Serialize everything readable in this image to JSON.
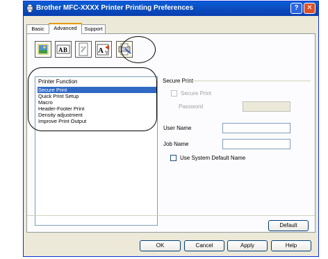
{
  "window": {
    "title": "Brother MFC-XXXX Printer Printing Preferences",
    "help": "?",
    "close": "✕"
  },
  "tabs": [
    "Basic",
    "Advanced",
    "Support"
  ],
  "toolbar": {
    "buttons": [
      {
        "name": "color-icon"
      },
      {
        "name": "scaling-icon"
      },
      {
        "name": "watermark-icon"
      },
      {
        "name": "print-setting-icon"
      },
      {
        "name": "device-options-icon"
      }
    ]
  },
  "printer_function": {
    "title": "Printer Function",
    "items": [
      "Secure Print",
      "Quick Print Setup",
      "Macro",
      "Header-Footer Print",
      "Density adjustment",
      "Improve Print Output"
    ],
    "selected_index": 0
  },
  "secure_print": {
    "group_title": "Secure Print",
    "secure_print_label": "Secure Print",
    "password_label": "Password",
    "password_value": "",
    "user_name_label": "User Name",
    "user_name_value": "",
    "job_name_label": "Job Name",
    "job_name_value": "",
    "use_default_label": "Use System Default Name"
  },
  "buttons": {
    "default": "Default",
    "ok": "OK",
    "cancel": "Cancel",
    "apply": "Apply",
    "help": "Help"
  }
}
